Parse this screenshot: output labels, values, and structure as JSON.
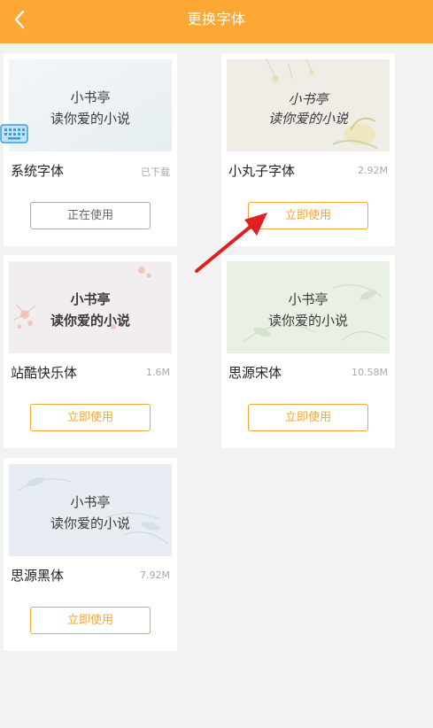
{
  "header": {
    "title": "更换字体",
    "back_icon": "chevron-left-icon"
  },
  "preview_text": {
    "line1": "小书亭",
    "line2": "读你爱的小说"
  },
  "fonts": [
    {
      "name": "系统字体",
      "meta": "已下载",
      "button": "正在使用"
    },
    {
      "name": "小丸子字体",
      "meta": "2.92M",
      "button": "立即使用"
    },
    {
      "name": "站酷快乐体",
      "meta": "1.6M",
      "button": "立即使用"
    },
    {
      "name": "思源宋体",
      "meta": "10.58M",
      "button": "立即使用"
    },
    {
      "name": "思源黑体",
      "meta": "7.92M",
      "button": "立即使用"
    }
  ],
  "colors": {
    "header_bg": "#fda735",
    "accent": "#f3a535",
    "arrow": "#e02020"
  }
}
